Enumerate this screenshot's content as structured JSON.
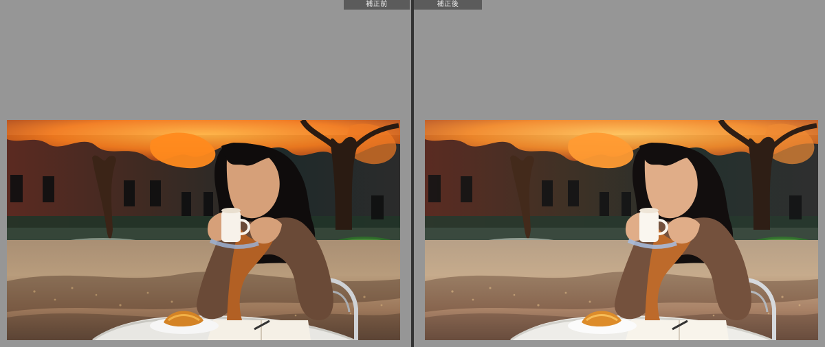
{
  "comparison": {
    "before_label": "補正前",
    "after_label": "補正後"
  },
  "photo": {
    "subject": "photo-content",
    "icons": {
      "before_image": "before-photo",
      "after_image": "after-photo"
    },
    "colors": {
      "background": "#959595",
      "divider": "#333333",
      "label_bg": "#5b5b5b",
      "label_text": "#eaeaea"
    }
  }
}
